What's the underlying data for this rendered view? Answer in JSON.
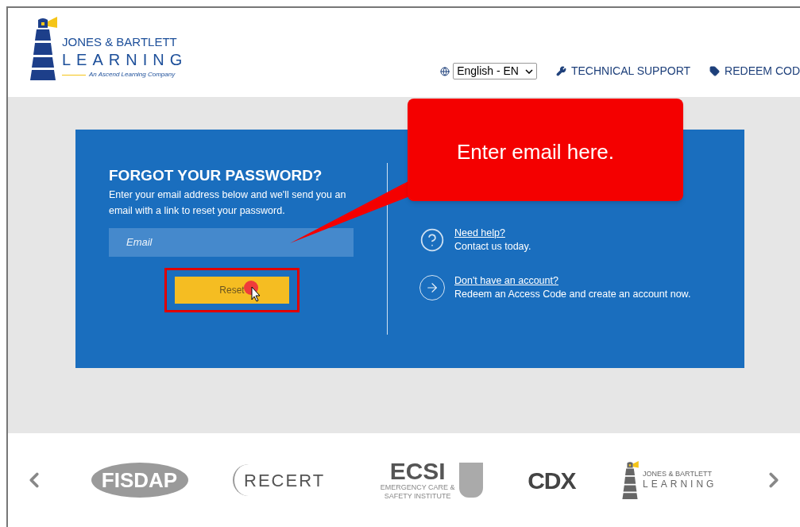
{
  "header": {
    "logo": {
      "line1": "JONES & BARTLETT",
      "line2": "LEARNING",
      "tagline": "An Ascend Learning Company"
    },
    "language": {
      "value": "English - EN"
    },
    "nav": [
      {
        "kind": "wrench",
        "label": "TECHNICAL SUPPORT"
      },
      {
        "kind": "tag",
        "label": "REDEEM COD"
      }
    ]
  },
  "forgot": {
    "title": "FORGOT YOUR PASSWORD?",
    "description": "Enter your email address below and we'll send you an email with a link to reset your password.",
    "email": {
      "placeholder": "Email"
    },
    "button": "Reset"
  },
  "help": [
    {
      "kind": "question",
      "link": "Need help?",
      "text": "Contact us today."
    },
    {
      "kind": "arrow",
      "link": "Don't have an account?",
      "text": "Redeem an Access Code and create an account now."
    }
  ],
  "annotation": {
    "callout": "Enter email here.",
    "highlight_reset": true,
    "cursor": true
  },
  "footer": {
    "logos": [
      {
        "kind": "fisdap",
        "text": "FISDAP"
      },
      {
        "kind": "recert",
        "text": "RECERT"
      },
      {
        "kind": "ecsi",
        "text": "ECSI",
        "subtext": "EMERGENCY CARE & SAFETY INSTITUTE"
      },
      {
        "kind": "cdx",
        "text": "CDX"
      },
      {
        "kind": "jbl",
        "text": "JONES & BARTLETT",
        "subtext": "LEARNING"
      }
    ]
  }
}
